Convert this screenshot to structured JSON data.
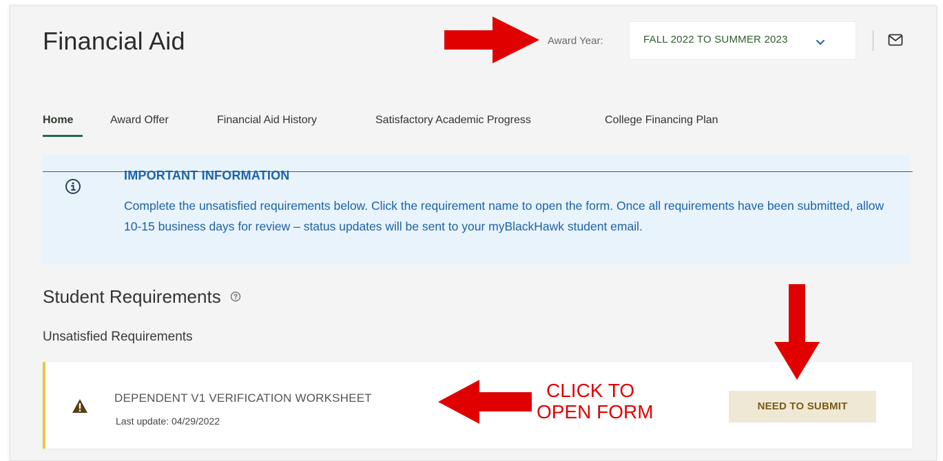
{
  "header": {
    "title": "Financial Aid",
    "award_year_label": "Award Year:",
    "award_year_value": "FALL 2022 TO SUMMER 2023",
    "icons": [
      "chevron-down-icon",
      "mail-icon"
    ]
  },
  "nav": {
    "tabs": [
      {
        "label": "Home",
        "active": true
      },
      {
        "label": "Award Offer"
      },
      {
        "label": "Financial Aid History"
      },
      {
        "label": "Satisfactory Academic Progress"
      },
      {
        "label": "College Financing Plan"
      }
    ]
  },
  "info": {
    "heading": "IMPORTANT INFORMATION",
    "body": "Complete the unsatisfied requirements below. Click the requirement name to open the form. Once all requirements have been submitted, allow 10-15 business days for review – status updates will be sent to your myBlackHawk student email.",
    "icon": "info-icon"
  },
  "requirements": {
    "section_title": "Student Requirements",
    "subheading": "Unsatisfied Requirements",
    "items": [
      {
        "name": "DEPENDENT V1 VERIFICATION WORKSHEET",
        "last_update": "Last update: 04/29/2022",
        "status": "NEED TO SUBMIT",
        "icon": "warning-icon"
      }
    ]
  },
  "annotations": {
    "callout_line1": "CLICK TO",
    "callout_line2": "OPEN FORM",
    "color": "#e00000"
  },
  "colors": {
    "accent_green": "#1f6b4a",
    "info_blue": "#1c63a8",
    "info_bg": "#e8f3fc",
    "warning_border": "#e6c84a",
    "badge_bg": "#efe8d5",
    "badge_text": "#7a5a16"
  }
}
